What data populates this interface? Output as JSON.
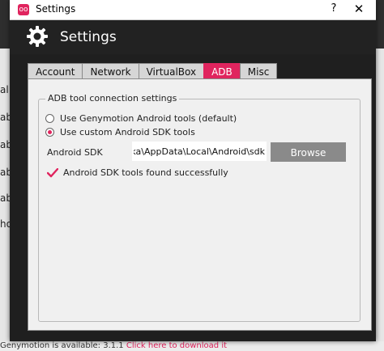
{
  "background": {
    "left_fragments": [
      "al",
      "ab",
      "ab",
      "ab",
      "ab",
      "ho"
    ],
    "bottom_text": "Genymotion is available: 3.1.1",
    "bottom_link": "Click here to download it"
  },
  "window": {
    "title": "Settings",
    "help_glyph": "?",
    "close_glyph": "✕",
    "header_title": "Settings"
  },
  "tabs": [
    {
      "label": "Account",
      "active": false
    },
    {
      "label": "Network",
      "active": false
    },
    {
      "label": "VirtualBox",
      "active": false
    },
    {
      "label": "ADB",
      "active": true
    },
    {
      "label": "Misc",
      "active": false
    }
  ],
  "adb": {
    "group_title": "ADB tool connection settings",
    "option_genymotion": "Use Genymotion Android tools (default)",
    "option_custom": "Use custom Android SDK tools",
    "selected_option": "custom",
    "sdk_label": "Android SDK",
    "sdk_path": "ika\\AppData\\Local\\Android\\sdk",
    "browse_label": "Browse",
    "status_text": "Android SDK tools found successfully"
  },
  "colors": {
    "accent": "#e0245e",
    "header_bg": "#222222",
    "panel_bg": "#f0f0f0"
  },
  "icons": {
    "app": "genymotion-logo-icon",
    "header": "gear-icon",
    "status": "checkmark-icon"
  }
}
